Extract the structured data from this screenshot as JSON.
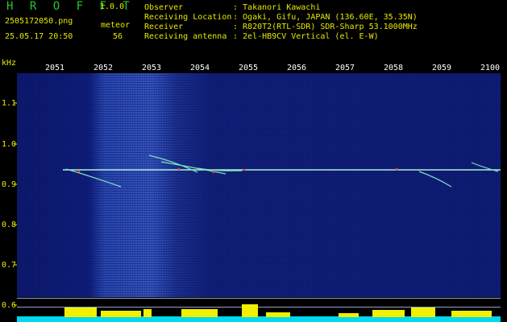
{
  "header": {
    "app_title": "H R O F F T",
    "app_version": "1.0.0",
    "file_name": "2505172050.png",
    "file_date": "25.05.17 20:50",
    "meteor_label": "meteor",
    "meteor_count": "56",
    "fields": [
      {
        "label": "Observer",
        "value": ": Takanori Kawachi"
      },
      {
        "label": "Receiving Location",
        "value": ": Ogaki, Gifu, JAPAN (136.60E, 35.35N)"
      },
      {
        "label": "Receiver",
        "value": ": R820T2(RTL-SDR) SDR-Sharp 53.1000MHz"
      },
      {
        "label": "Receiving antenna",
        "value": ": 2el-HB9CV Vertical (el. E-W)"
      }
    ]
  },
  "axis": {
    "unit": "kHz",
    "y_ticks": [
      "1.1",
      "1.0",
      "0.9",
      "0.8",
      "0.7",
      "0.6"
    ],
    "x_ticks": [
      "2051",
      "2052",
      "2053",
      "2054",
      "2055",
      "2056",
      "2057",
      "2058",
      "2059",
      "2100"
    ]
  },
  "colors": {
    "title_green": "#28c828",
    "label_yellow": "#e8e800",
    "carrier_line": "#9fe8d0",
    "band_yellow": "#f0f000",
    "band_cyan": "#00e0f0"
  }
}
